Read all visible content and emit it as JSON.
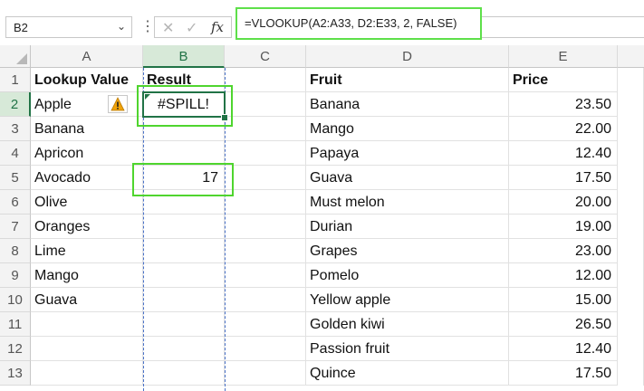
{
  "name_box": {
    "value": "B2",
    "dropdown_icon": "chevron-down-icon"
  },
  "formula_bar": {
    "separator_icon": "more-options-icon",
    "cancel_icon": "cancel-icon",
    "enter_icon": "check-icon",
    "fx_label": "fx",
    "formula": "=VLOOKUP(A2:A33, D2:E33, 2, FALSE)"
  },
  "columns": [
    "A",
    "B",
    "C",
    "D",
    "E"
  ],
  "rows": [
    "1",
    "2",
    "3",
    "4",
    "5",
    "6",
    "7",
    "8",
    "9",
    "10",
    "11",
    "12",
    "13"
  ],
  "cells": {
    "A": [
      "Lookup Value",
      "Apple",
      "Banana",
      "Apricon",
      "Avocado",
      "Olive",
      "Oranges",
      "Lime",
      "Mango",
      "Guava",
      "",
      "",
      ""
    ],
    "B": [
      "Result",
      "#SPILL!",
      "",
      "",
      "17",
      "",
      "",
      "",
      "",
      "",
      "",
      "",
      ""
    ],
    "D": [
      "Fruit",
      "Banana",
      "Mango",
      "Papaya",
      "Guava",
      "Must melon",
      "Durian",
      "Grapes",
      "Pomelo",
      "Yellow apple",
      "Golden kiwi",
      "Passion fruit",
      "Quince"
    ],
    "E": [
      "Price",
      "23.50",
      "22.00",
      "12.40",
      "17.50",
      "20.00",
      "19.00",
      "23.00",
      "12.00",
      "15.00",
      "26.50",
      "12.40",
      "17.50"
    ]
  },
  "selected_cell": "B2",
  "warning_icon": "warning-icon",
  "colors": {
    "highlight": "#4fd52e",
    "excel_green": "#217346",
    "spill_border": "#4a72c8",
    "warning": "#f0a30a"
  }
}
